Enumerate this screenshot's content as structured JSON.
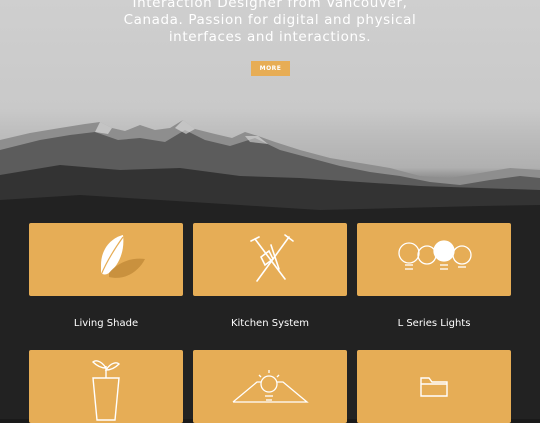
{
  "intro": {
    "line1": "Interaction Designer from Vancouver,",
    "line2": "Canada. Passion for digital and physical",
    "line3": "interfaces and interactions."
  },
  "more_button": {
    "label": "MORE"
  },
  "projects": [
    {
      "label": "Living Shade",
      "icon": "leaf-icon"
    },
    {
      "label": "Kitchen System",
      "icon": "kitchen-tools-icon"
    },
    {
      "label": "L Series Lights",
      "icon": "light-bulbs-icon"
    },
    {
      "label": "",
      "icon": "plant-glass-icon"
    },
    {
      "label": "",
      "icon": "lamp-mountain-icon"
    },
    {
      "label": "",
      "icon": "folder-icon"
    }
  ],
  "colors": {
    "accent": "#e6ad56",
    "text": "#ffffff"
  }
}
